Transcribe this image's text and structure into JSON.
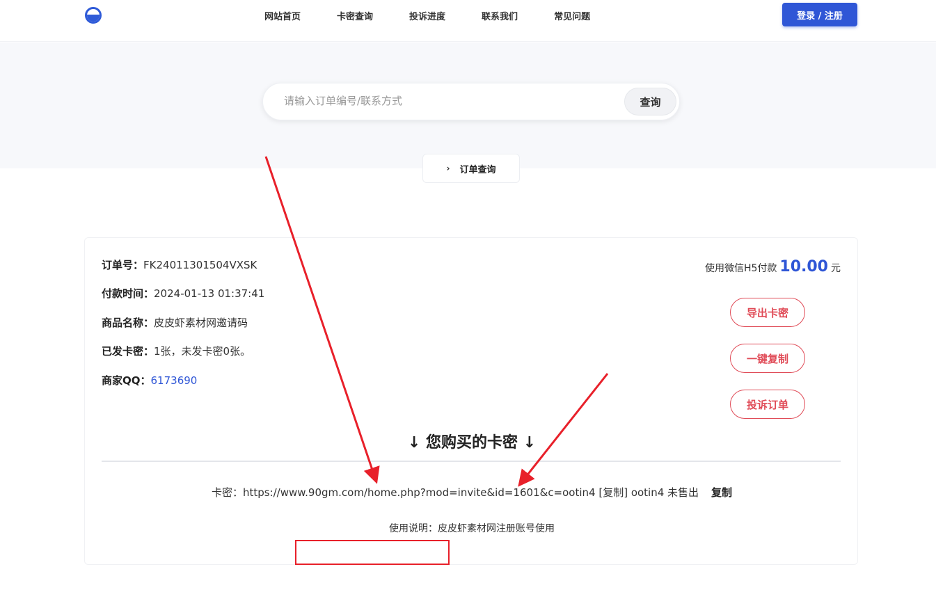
{
  "header": {
    "nav": [
      "网站首页",
      "卡密查询",
      "投诉进度",
      "联系我们",
      "常见问题"
    ],
    "login_label": "登录 / 注册",
    "brand_color": "#2f56d6"
  },
  "search": {
    "placeholder": "请输入订单编号/联系方式",
    "button_label": "查询"
  },
  "breadcrumb": {
    "icon": "chevron-right-icon",
    "label": "订单查询"
  },
  "order": {
    "order_no_label": "订单号：",
    "order_no": "FK24011301504VXSK",
    "pay_time_label": "付款时间：",
    "pay_time": "2024-01-13 01:37:41",
    "product_label": "商品名称：",
    "product": "皮皮虾素材网邀请码",
    "issued_label": "已发卡密：",
    "issued": "1张，未发卡密0张。",
    "qq_label": "商家QQ：",
    "qq": "6173690",
    "pay_method": "使用微信H5付款",
    "amount": "10.00",
    "currency": "元",
    "actions": [
      "导出卡密",
      "一键复制",
      "投诉订单"
    ],
    "accent_color": "#e04b57"
  },
  "keys": {
    "title": "↓ 您购买的卡密 ↓",
    "line": "卡密：https://www.90gm.com/home.php?mod=invite&id=1601&c=ootin4 [复制] ootin4 未售出",
    "copy_label": "复制",
    "usage": "使用说明：皮皮虾素材网注册账号使用"
  },
  "annotations": {
    "color": "#e8202a"
  }
}
